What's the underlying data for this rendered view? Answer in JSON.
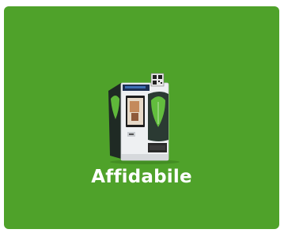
{
  "card": {
    "label": "Affidabile",
    "background_color": "#4fa22a",
    "illustration": "vending-kiosk-machine-image"
  }
}
